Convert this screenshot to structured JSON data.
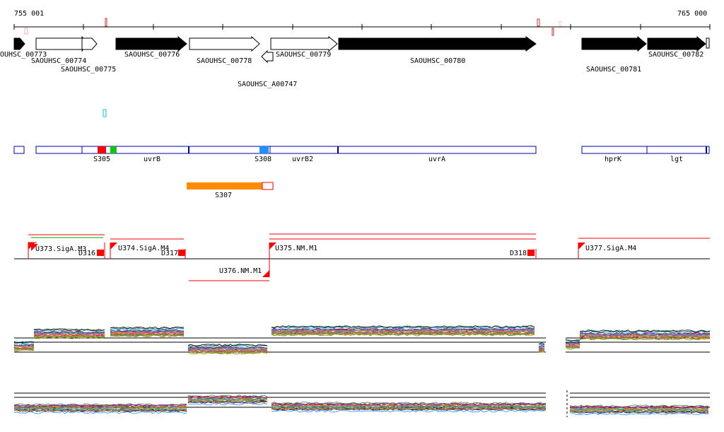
{
  "ruler": {
    "start_label": "755 001",
    "end_label": "765 000"
  },
  "genes": [
    {
      "id": "SAOUHSC_00773",
      "label": "OUHSC_00773",
      "strand": "+",
      "style": "filled"
    },
    {
      "id": "SAOUHSC_00774",
      "label": "SAOUHSC_00774",
      "strand": "+",
      "style": "open"
    },
    {
      "id": "SAOUHSC_00775",
      "label": "SAOUHSC_00775",
      "strand": "+",
      "style": "open"
    },
    {
      "id": "SAOUHSC_00776",
      "label": "SAOUHSC_00776",
      "strand": "+",
      "style": "filled"
    },
    {
      "id": "SAOUHSC_00778",
      "label": "SAOUHSC_00778",
      "strand": "+",
      "style": "open"
    },
    {
      "id": "SAOUHSC_A00747",
      "label": "SAOUHSC_A00747",
      "strand": "-",
      "style": "open"
    },
    {
      "id": "SAOUHSC_00779",
      "label": "SAOUHSC_00779",
      "strand": "+",
      "style": "open"
    },
    {
      "id": "SAOUHSC_00780",
      "label": "SAOUHSC_00780",
      "strand": "+",
      "style": "filled"
    },
    {
      "id": "SAOUHSC_00781",
      "label": "SAOUHSC_00781",
      "strand": "+",
      "style": "filled"
    },
    {
      "id": "SAOUHSC_00782",
      "label": "SAOUHSC_00782",
      "strand": "+",
      "style": "filled"
    }
  ],
  "features": [
    {
      "label": "S305",
      "color": "#ff0000"
    },
    {
      "label": "uvrB",
      "color": "#0000aa"
    },
    {
      "label": "S308",
      "color": "#1e90ff"
    },
    {
      "label": "uvrB2",
      "color": "#0000aa"
    },
    {
      "label": "uvrA",
      "color": "#0000aa"
    },
    {
      "label": "hprK",
      "color": "#0000aa"
    },
    {
      "label": "lgt",
      "color": "#0000aa"
    },
    {
      "label": "S307",
      "color": "#ff8c00"
    }
  ],
  "regulatory": {
    "promoters": [
      "U373.SigA.M3",
      "U374.SigA.M4",
      "U375.NM.M1",
      "U376.NM.M1",
      "U377.SigA.M4"
    ],
    "terminators": [
      "D316",
      "D317",
      "D318"
    ]
  },
  "colors": {
    "axis": "#000000",
    "gene_fill": "#000000",
    "feature_outline": "#0000aa",
    "regulatory": "#ff0000",
    "orange": "#ff8c00",
    "cyan": "#00cccc",
    "green": "#00aa00"
  }
}
